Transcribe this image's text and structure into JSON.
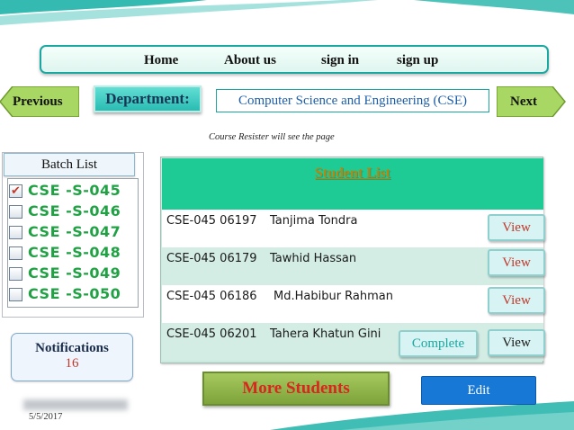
{
  "navbar": {
    "items": [
      "Home",
      "About us",
      "sign in",
      "sign up"
    ]
  },
  "nav_arrows": {
    "previous": "Previous",
    "next": "Next"
  },
  "department": {
    "label": "Department:",
    "value": "Computer Science and Engineering (CSE)"
  },
  "hint": "Course Resister will see the page",
  "batch": {
    "title": "Batch List",
    "items": [
      {
        "label": "CSE -S-045",
        "checked": true
      },
      {
        "label": "CSE -S-046",
        "checked": false
      },
      {
        "label": "CSE -S-047",
        "checked": false
      },
      {
        "label": "CSE -S-048",
        "checked": false
      },
      {
        "label": "CSE -S-049",
        "checked": false
      },
      {
        "label": "CSE -S-050",
        "checked": false
      }
    ]
  },
  "notifications": {
    "label": "Notifications",
    "count": "16"
  },
  "date": "5/5/2017",
  "student_list": {
    "title": "Student List",
    "rows": [
      {
        "id": "CSE-045 06197",
        "name": "Tanjima  Tondra",
        "view": "View"
      },
      {
        "id": "CSE-045 06179",
        "name": "Tawhid Hassan",
        "view": "View"
      },
      {
        "id": "CSE-045 06186",
        "name": "Md.Habibur Rahman",
        "view": "View"
      },
      {
        "id": "CSE-045 06201",
        "name": "Tahera Khatun Gini",
        "complete": "Complete",
        "view": "View"
      }
    ]
  },
  "actions": {
    "more": "More  Students",
    "edit": "Edit"
  },
  "colors": {
    "teal": "#1aa7a0",
    "header_green": "#1ecb95",
    "batch_green": "#20a244",
    "accent_red": "#c0392b",
    "edit_blue": "#1878d6"
  }
}
